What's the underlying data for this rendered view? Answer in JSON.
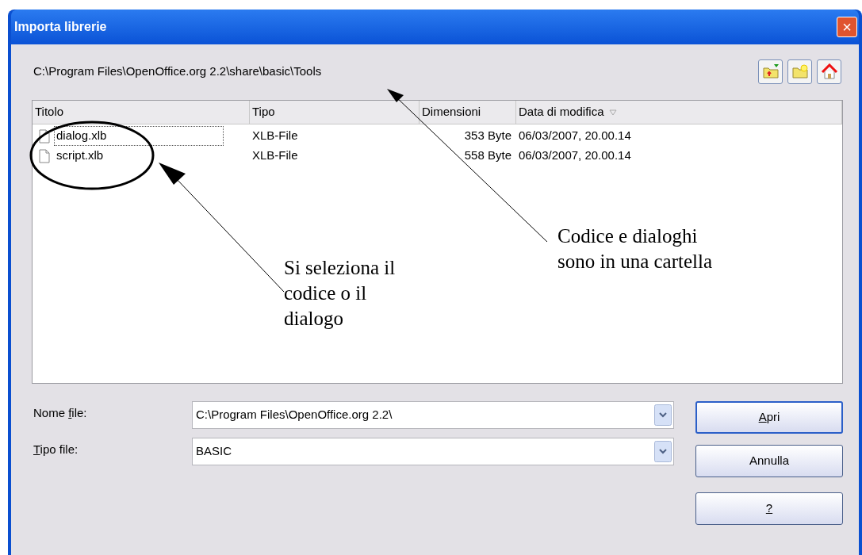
{
  "window": {
    "title": "Importa librerie",
    "close": "×"
  },
  "path": "C:\\Program Files\\OpenOffice.org 2.2\\share\\basic\\Tools",
  "toolbar": [
    {
      "kind": "up"
    },
    {
      "kind": "newfolder"
    },
    {
      "kind": "home"
    }
  ],
  "table": {
    "columns": [
      {
        "label": "Titolo",
        "sorted": false
      },
      {
        "label": "Tipo",
        "sorted": false
      },
      {
        "label": "Dimensioni",
        "sorted": false
      },
      {
        "label": "Data di modifica",
        "sorted": true
      }
    ],
    "rows": [
      {
        "cells": [
          "dialog.xlb",
          "XLB-File",
          "353 Byte",
          "06/03/2007, 20.00.14"
        ],
        "focused": true
      },
      {
        "cells": [
          "script.xlb",
          "XLB-File",
          "558 Byte",
          "06/03/2007, 20.00.14"
        ],
        "focused": false
      }
    ]
  },
  "fields": [
    {
      "label": {
        "before": "Nome ",
        "key": "f",
        "after": "ile:"
      },
      "value": "C:\\Program Files\\OpenOffice.org 2.2\\"
    },
    {
      "label": {
        "key": "T",
        "after": "ipo file:"
      },
      "value": "BASIC"
    }
  ],
  "buttons": [
    {
      "label": {
        "key": "A",
        "after": "pri"
      },
      "default": true
    },
    {
      "label": {
        "before": "Annulla"
      },
      "default": false
    },
    {
      "label": {
        "key": "?"
      },
      "default": false
    }
  ],
  "annotations": [
    {
      "text": "Si seleziona il\ncodice o il\ndialogo"
    },
    {
      "text": "Codice e dialoghi\nsono in una cartella"
    }
  ]
}
